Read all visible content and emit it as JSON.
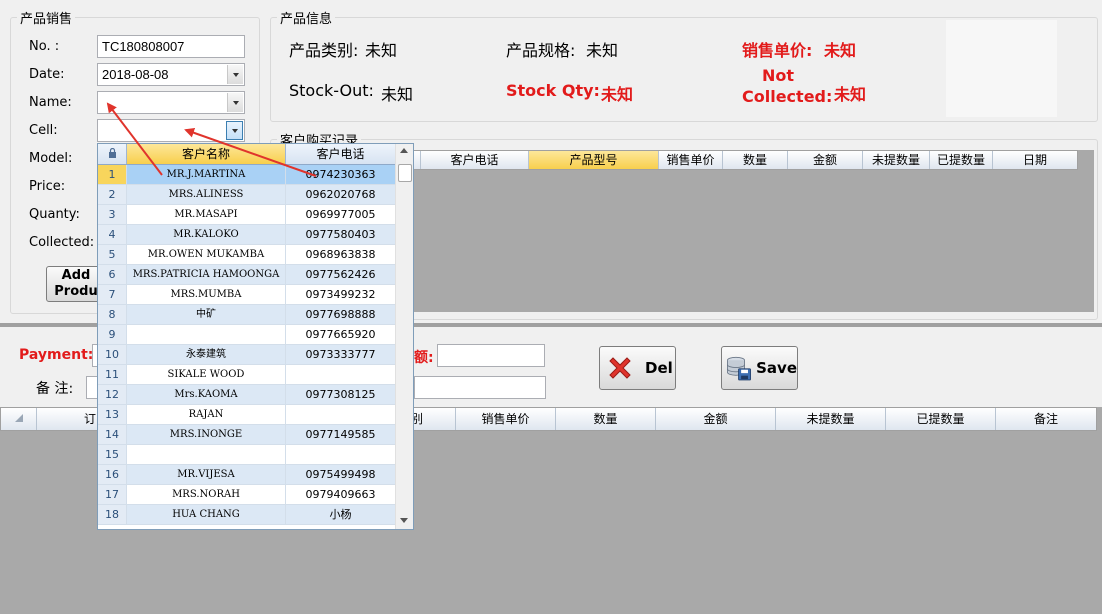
{
  "sales_group": {
    "title": "产品销售",
    "fields": [
      {
        "label": "No. :",
        "value": "TC180808007"
      },
      {
        "label": "Date:",
        "value": "2018-08-08"
      },
      {
        "label": "Name:",
        "value": ""
      },
      {
        "label": "Cell:",
        "value": ""
      },
      {
        "label": "Model:"
      },
      {
        "label": "Price:"
      },
      {
        "label": "Quanty:"
      },
      {
        "label": "Collected:"
      }
    ],
    "add_button_line1": "Add",
    "add_button_line2": "Produ"
  },
  "product_info": {
    "title": "产品信息",
    "category_label": "产品类别:",
    "category_value": "未知",
    "spec_label": "产品规格:",
    "spec_value": "未知",
    "price_label": "销售单价:",
    "price_value": "未知",
    "stockout_label": "Stock-Out:",
    "stockout_value": "未知",
    "stockqty_label": "Stock Qty:",
    "stockqty_value": "未知",
    "notcollected_line1": "Not",
    "notcollected_line2": "Collected:",
    "notcollected_value": "未知"
  },
  "history": {
    "title": "客户购买记录",
    "columns": [
      "客户电话",
      "产品型号",
      "销售单价",
      "数量",
      "金额",
      "未提数量",
      "已提数量",
      "日期"
    ]
  },
  "dropdown": {
    "header_name": "客户名称",
    "header_phone": "客户电话",
    "rows": [
      {
        "n": "1",
        "name": "MR.J.MARTINA",
        "phone": "0974230363"
      },
      {
        "n": "2",
        "name": "MRS.ALINESS",
        "phone": "0962020768"
      },
      {
        "n": "3",
        "name": "MR.MASAPI",
        "phone": "0969977005"
      },
      {
        "n": "4",
        "name": "MR.KALOKO",
        "phone": "0977580403"
      },
      {
        "n": "5",
        "name": "MR.OWEN MUKAMBA",
        "phone": "0968963838"
      },
      {
        "n": "6",
        "name": "MRS.PATRICIA HAMOONGA",
        "phone": "0977562426"
      },
      {
        "n": "7",
        "name": "MRS.MUMBA",
        "phone": "0973499232"
      },
      {
        "n": "8",
        "name": "中矿",
        "phone": "0977698888"
      },
      {
        "n": "9",
        "name": "",
        "phone": "0977665920"
      },
      {
        "n": "10",
        "name": "永泰建筑",
        "phone": "0973333777"
      },
      {
        "n": "11",
        "name": "SIKALE WOOD",
        "phone": ""
      },
      {
        "n": "12",
        "name": "Mrs.KAOMA",
        "phone": "0977308125"
      },
      {
        "n": "13",
        "name": "RAJAN",
        "phone": ""
      },
      {
        "n": "14",
        "name": "MRS.INONGE",
        "phone": "0977149585"
      },
      {
        "n": "15",
        "name": "",
        "phone": ""
      },
      {
        "n": "16",
        "name": "MR.VIJESA",
        "phone": "0975499498"
      },
      {
        "n": "17",
        "name": "MRS.NORAH",
        "phone": "0979409663"
      },
      {
        "n": "18",
        "name": "HUA CHANG",
        "phone": "小杨"
      }
    ]
  },
  "payment": {
    "payment_label": "Payment:",
    "amount_label_fragment": "额:",
    "remark_label": "备  注:",
    "del_label": "Del",
    "save_label": "Save"
  },
  "bottom_grid": {
    "first_fragment": "订",
    "col_fragment": "别",
    "columns": [
      "销售单价",
      "数量",
      "金额",
      "未提数量",
      "已提数量",
      "备注"
    ]
  },
  "colors": {
    "accent_red": "#e21b1b",
    "highlight_header": "#f8cf4d",
    "grid_background": "#a9a9a9",
    "annotation_arrow": "#e0342c"
  }
}
